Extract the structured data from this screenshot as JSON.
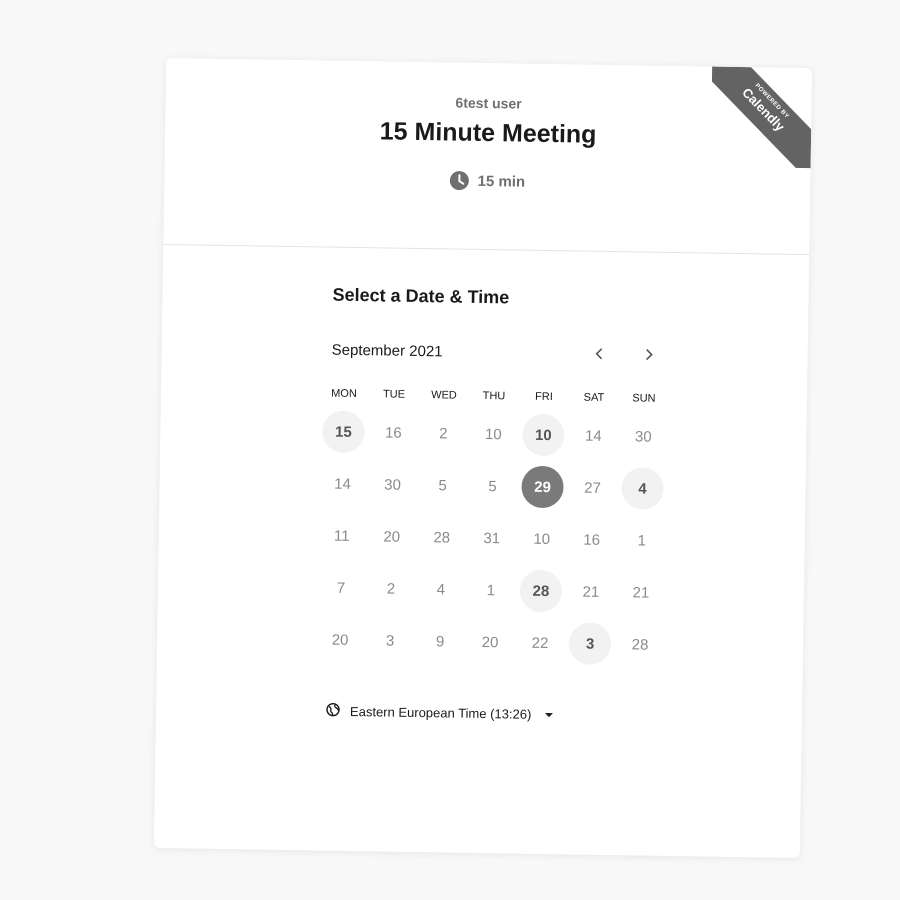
{
  "header": {
    "owner": "6test user",
    "title": "15 Minute Meeting",
    "duration": "15 min",
    "clock_icon": "clock-icon"
  },
  "badge": {
    "small_text": "POWERED BY",
    "brand": "Calendly",
    "color": "#636363"
  },
  "calendar": {
    "section_title": "Select a Date & Time",
    "month": "September 2021",
    "prev_icon": "chevron-left-icon",
    "next_icon": "chevron-right-icon",
    "weekdays": [
      "MON",
      "TUE",
      "WED",
      "THU",
      "FRI",
      "SAT",
      "SUN"
    ],
    "weeks": [
      [
        {
          "d": "15",
          "s": "available"
        },
        {
          "d": "16",
          "s": ""
        },
        {
          "d": "2",
          "s": ""
        },
        {
          "d": "10",
          "s": ""
        },
        {
          "d": "10",
          "s": "available"
        },
        {
          "d": "14",
          "s": ""
        },
        {
          "d": "30",
          "s": ""
        }
      ],
      [
        {
          "d": "14",
          "s": ""
        },
        {
          "d": "30",
          "s": ""
        },
        {
          "d": "5",
          "s": ""
        },
        {
          "d": "5",
          "s": ""
        },
        {
          "d": "29",
          "s": "selected"
        },
        {
          "d": "27",
          "s": ""
        },
        {
          "d": "4",
          "s": "available"
        }
      ],
      [
        {
          "d": "11",
          "s": ""
        },
        {
          "d": "20",
          "s": ""
        },
        {
          "d": "28",
          "s": ""
        },
        {
          "d": "31",
          "s": ""
        },
        {
          "d": "10",
          "s": ""
        },
        {
          "d": "16",
          "s": ""
        },
        {
          "d": "1",
          "s": ""
        }
      ],
      [
        {
          "d": "7",
          "s": ""
        },
        {
          "d": "2",
          "s": ""
        },
        {
          "d": "4",
          "s": ""
        },
        {
          "d": "1",
          "s": ""
        },
        {
          "d": "28",
          "s": "available"
        },
        {
          "d": "21",
          "s": ""
        },
        {
          "d": "21",
          "s": ""
        }
      ],
      [
        {
          "d": "20",
          "s": ""
        },
        {
          "d": "3",
          "s": ""
        },
        {
          "d": "9",
          "s": ""
        },
        {
          "d": "20",
          "s": ""
        },
        {
          "d": "22",
          "s": ""
        },
        {
          "d": "3",
          "s": "available"
        },
        {
          "d": "28",
          "s": ""
        }
      ]
    ],
    "selected_color": "#7a7a7a",
    "available_color": "#f2f2f2"
  },
  "timezone": {
    "label": "Eastern European Time (13:26)",
    "icon": "globe-icon"
  }
}
